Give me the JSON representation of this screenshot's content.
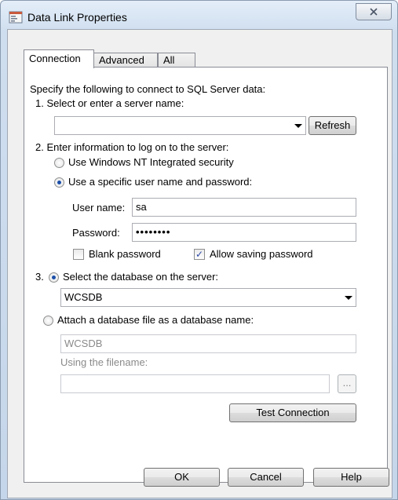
{
  "window": {
    "title": "Data Link Properties"
  },
  "tabs": [
    {
      "label": "Connection",
      "active": true
    },
    {
      "label": "Advanced",
      "active": false
    },
    {
      "label": "All",
      "active": false
    }
  ],
  "intro": "Specify the following to connect to SQL Server data:",
  "step1": {
    "label": "1. Select or enter a server name:",
    "server_value": "",
    "refresh_label": "Refresh"
  },
  "step2": {
    "label": "2. Enter information to log on to the server:",
    "nt_security_label": "Use Windows NT Integrated security",
    "specific_user_label": "Use a specific user name and password:",
    "username_label": "User name:",
    "username_value": "sa",
    "password_label": "Password:",
    "password_value": "••••••••",
    "blank_password_label": "Blank password",
    "blank_password_checked": false,
    "allow_saving_label": "Allow saving password",
    "allow_saving_checked": true
  },
  "step3": {
    "number": "3.",
    "select_db_label": "Select the database on the server:",
    "database_value": "WCSDB",
    "attach_label": "Attach a database file as a database name:",
    "attach_name_value": "WCSDB",
    "filename_label": "Using the filename:",
    "filename_value": "",
    "browse_label": "...",
    "test_connection_label": "Test Connection"
  },
  "footer": {
    "ok_label": "OK",
    "cancel_label": "Cancel",
    "help_label": "Help"
  }
}
